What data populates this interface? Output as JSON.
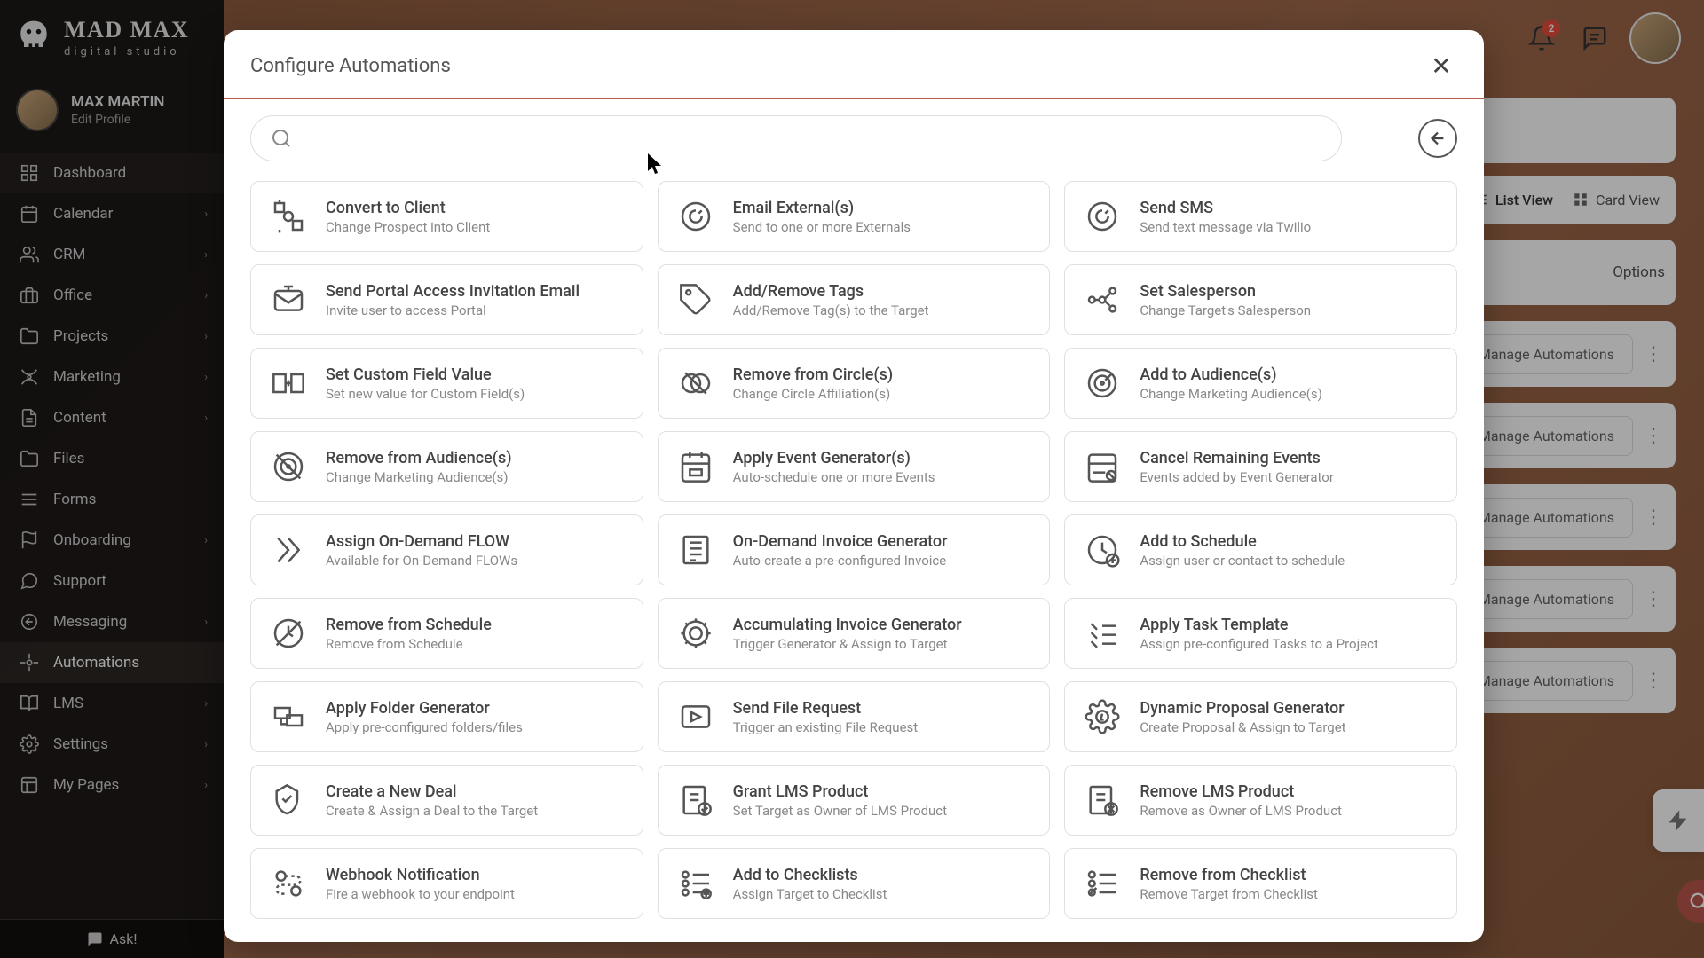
{
  "brand": {
    "main": "MAD MAX",
    "sub": "digital studio"
  },
  "profile": {
    "name": "MAX MARTIN",
    "edit": "Edit Profile"
  },
  "nav": {
    "items": [
      {
        "label": "Dashboard"
      },
      {
        "label": "Calendar"
      },
      {
        "label": "CRM"
      },
      {
        "label": "Office"
      },
      {
        "label": "Projects"
      },
      {
        "label": "Marketing"
      },
      {
        "label": "Content"
      },
      {
        "label": "Files"
      },
      {
        "label": "Forms"
      },
      {
        "label": "Onboarding"
      },
      {
        "label": "Support"
      },
      {
        "label": "Messaging"
      },
      {
        "label": "Automations"
      },
      {
        "label": "LMS"
      },
      {
        "label": "Settings"
      },
      {
        "label": "My Pages"
      }
    ],
    "ask": "Ask!"
  },
  "header": {
    "notification_count": "2"
  },
  "bgviews": {
    "list": "List View",
    "card": "Card View",
    "options": "Options",
    "manage": "Manage Automations"
  },
  "modal": {
    "title": "Configure Automations",
    "cards": [
      [
        {
          "title": "Convert to Client",
          "sub": "Change Prospect into Client"
        },
        {
          "title": "Email External(s)",
          "sub": "Send to one or more Externals"
        },
        {
          "title": "Send SMS",
          "sub": "Send text message via Twilio"
        }
      ],
      [
        {
          "title": "Send Portal Access Invitation Email",
          "sub": "Invite user to access Portal"
        },
        {
          "title": "Add/Remove Tags",
          "sub": "Add/Remove Tag(s) to the Target"
        },
        {
          "title": "Set Salesperson",
          "sub": "Change Target's Salesperson"
        }
      ],
      [
        {
          "title": "Set Custom Field Value",
          "sub": "Set new value for Custom Field(s)"
        },
        {
          "title": "Remove from Circle(s)",
          "sub": "Change Circle Affiliation(s)"
        },
        {
          "title": "Add to Audience(s)",
          "sub": "Change Marketing Audience(s)"
        }
      ],
      [
        {
          "title": "Remove from Audience(s)",
          "sub": "Change Marketing Audience(s)"
        },
        {
          "title": "Apply Event Generator(s)",
          "sub": "Auto-schedule one or more Events"
        },
        {
          "title": "Cancel Remaining Events",
          "sub": "Events added by Event Generator"
        }
      ],
      [
        {
          "title": "Assign On-Demand FLOW",
          "sub": "Available for On-Demand FLOWs"
        },
        {
          "title": "On-Demand Invoice Generator",
          "sub": "Auto-create a pre-configured Invoice"
        },
        {
          "title": "Add to Schedule",
          "sub": "Assign user or contact to schedule"
        }
      ],
      [
        {
          "title": "Remove from Schedule",
          "sub": "Remove from Schedule"
        },
        {
          "title": "Accumulating Invoice Generator",
          "sub": "Trigger Generator & Assign to Target"
        },
        {
          "title": "Apply Task Template",
          "sub": "Assign pre-configured Tasks to a Project"
        }
      ],
      [
        {
          "title": "Apply Folder Generator",
          "sub": "Apply pre-configured folders/files"
        },
        {
          "title": "Send File Request",
          "sub": "Trigger an existing File Request"
        },
        {
          "title": "Dynamic Proposal Generator",
          "sub": "Create Proposal & Assign to Target"
        }
      ],
      [
        {
          "title": "Create a New Deal",
          "sub": "Create & Assign a Deal to the Target"
        },
        {
          "title": "Grant LMS Product",
          "sub": "Set Target as Owner of LMS Product"
        },
        {
          "title": "Remove LMS Product",
          "sub": "Remove as Owner of LMS Product"
        }
      ],
      [
        {
          "title": "Webhook Notification",
          "sub": "Fire a webhook to your endpoint"
        },
        {
          "title": "Add to Checklists",
          "sub": "Assign Target to Checklist"
        },
        {
          "title": "Remove from Checklist",
          "sub": "Remove Target from Checklist"
        }
      ]
    ]
  }
}
